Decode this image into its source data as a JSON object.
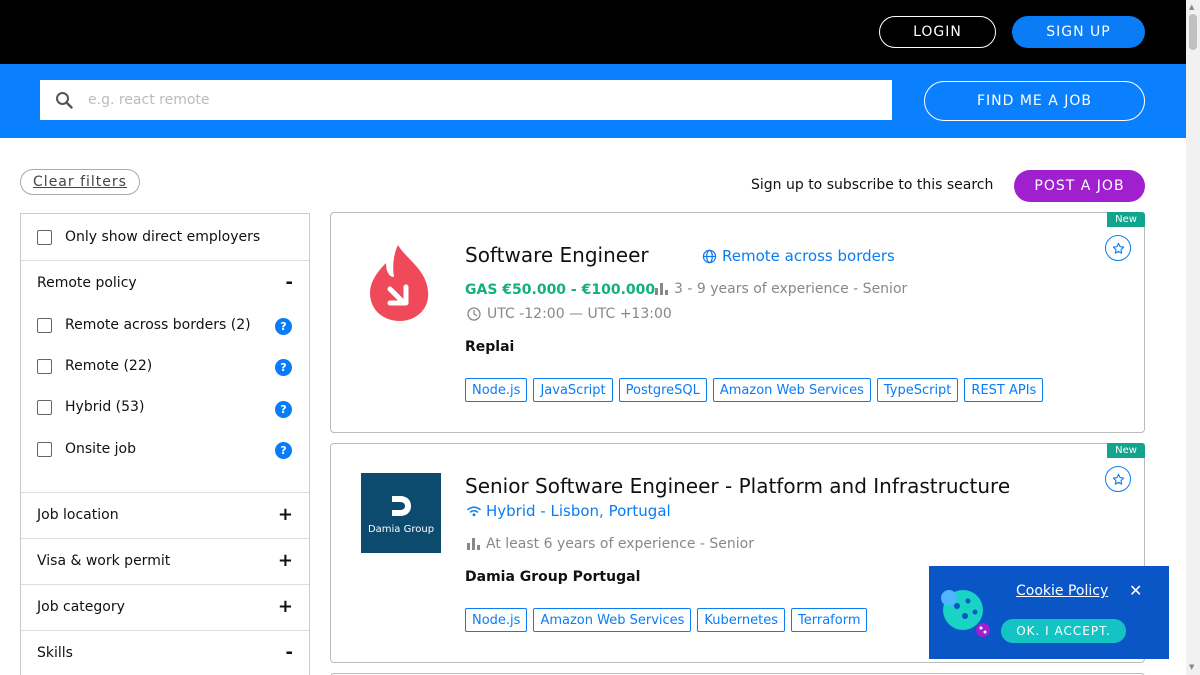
{
  "header": {
    "login_label": "LOGIN",
    "signup_label": "SIGN UP"
  },
  "search": {
    "placeholder": "e.g. react remote",
    "find_label": "FIND ME A JOB"
  },
  "toolbar": {
    "clear_filters_label": "Clear filters",
    "subscribe_text": "Sign up to subscribe to this search",
    "post_job_label": "POST A JOB"
  },
  "sidebar": {
    "direct_employers_label": "Only show direct employers",
    "remote_policy": {
      "title": "Remote policy",
      "toggle": "-",
      "options": [
        {
          "label": "Remote across borders (2)"
        },
        {
          "label": "Remote (22)"
        },
        {
          "label": "Hybrid (53)"
        },
        {
          "label": "Onsite job"
        }
      ]
    },
    "sections": [
      {
        "title": "Job location",
        "toggle": "+"
      },
      {
        "title": "Visa & work permit",
        "toggle": "+"
      },
      {
        "title": "Job category",
        "toggle": "+"
      },
      {
        "title": "Skills",
        "toggle": "-"
      }
    ]
  },
  "jobs": [
    {
      "badge": "New",
      "title": "Software Engineer",
      "remote_tag": "Remote across borders",
      "salary": "GAS €50.000 - €100.000",
      "experience": "3 - 9 years of experience - Senior",
      "timezone": "UTC -12:00 — UTC +13:00",
      "company": "Replai",
      "tags": [
        "Node.js",
        "JavaScript",
        "PostgreSQL",
        "Amazon Web Services",
        "TypeScript",
        "REST APIs"
      ]
    },
    {
      "badge": "New",
      "title": "Senior Software Engineer - Platform and Infrastructure",
      "remote_tag": "Hybrid - Lisbon, Portugal",
      "experience": "At least 6 years of experience - Senior",
      "company": "Damia Group Portugal",
      "logo_text": "Damia Group",
      "tags": [
        "Node.js",
        "Amazon Web Services",
        "Kubernetes",
        "Terraform"
      ]
    }
  ],
  "cookie": {
    "policy_label": "Cookie Policy",
    "close": "✕",
    "accept_label": "OK. I ACCEPT."
  },
  "colors": {
    "accent": "#0a7cf5",
    "header_bg": "#000000",
    "search_bg": "#0a80ff",
    "post_job": "#a020d0",
    "new_badge": "#12a48c",
    "salary": "#12b07c"
  }
}
